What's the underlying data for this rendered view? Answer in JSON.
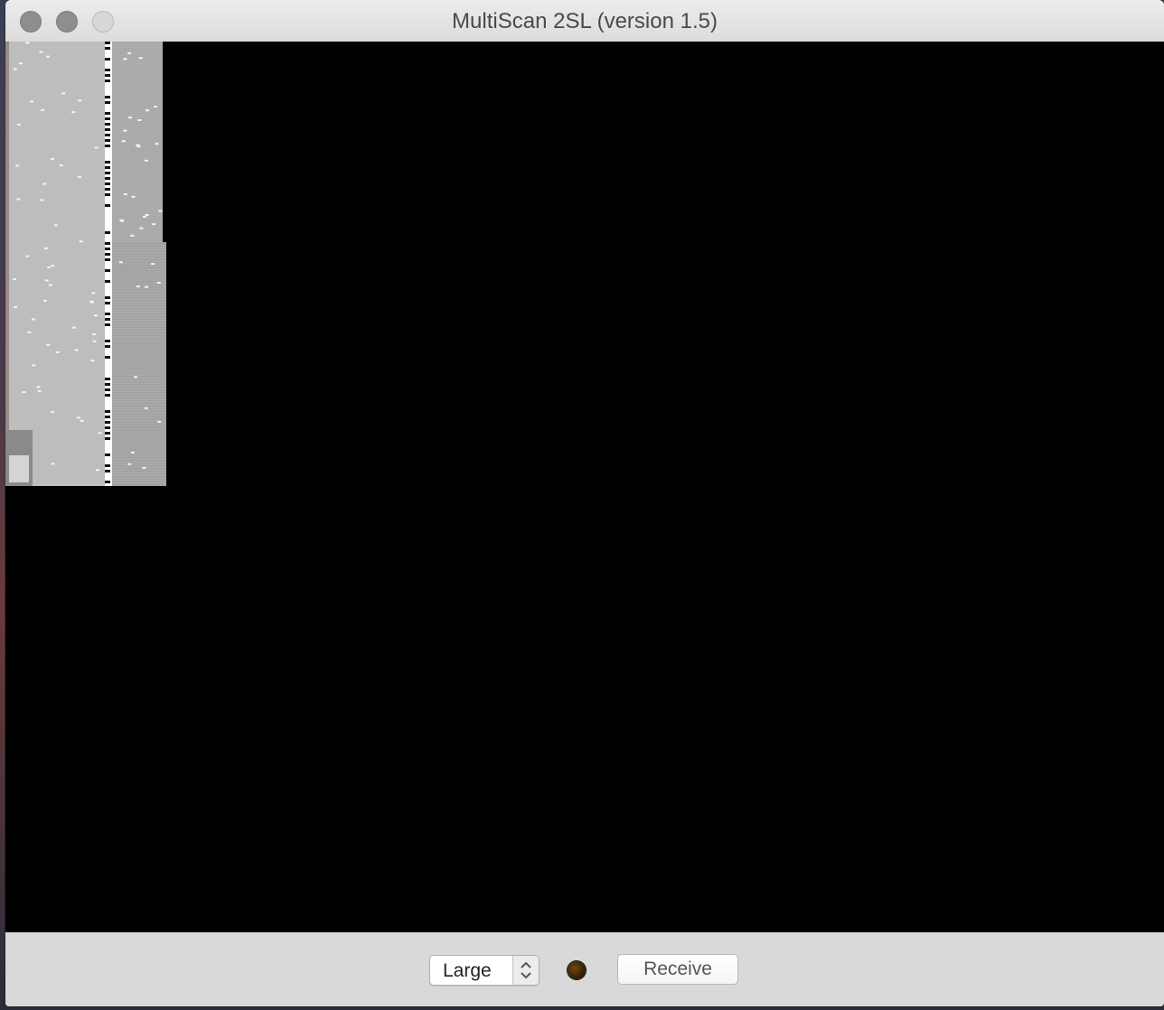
{
  "window": {
    "title": "MultiScan 2SL (version 1.5)"
  },
  "controls": {
    "size_select": {
      "selected": "Large"
    },
    "status_indicator": {
      "color": "#3a2408"
    },
    "receive_button": {
      "label": "Receive"
    }
  },
  "colors": {
    "canvas_background": "#000000",
    "toolbar_background": "#d9d9d9"
  }
}
